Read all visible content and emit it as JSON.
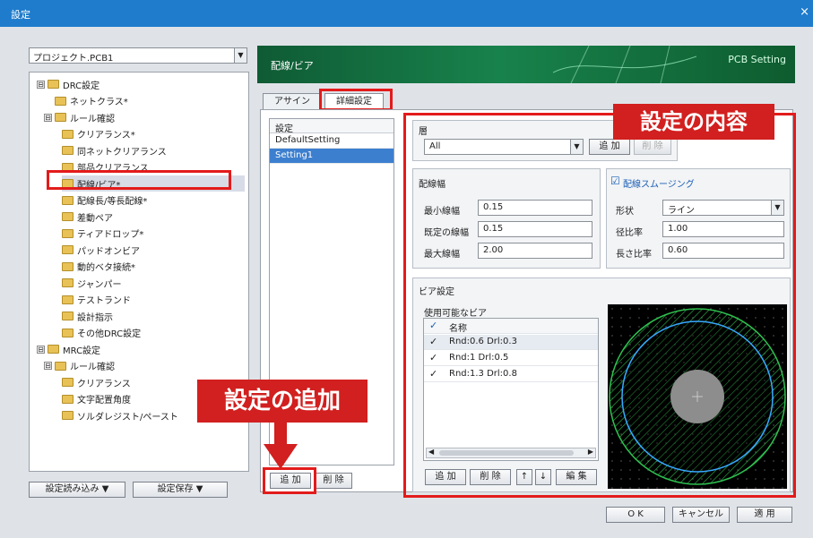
{
  "window": {
    "title": "設定",
    "close_label": "×"
  },
  "project": {
    "value": "プロジェクト.PCB1"
  },
  "tree": [
    {
      "label": "DRC設定",
      "expander": "⊟"
    },
    {
      "label": "ネットクラス*"
    },
    {
      "label": "ルール確認",
      "expander": "⊟"
    },
    {
      "label": "クリアランス*"
    },
    {
      "label": "同ネットクリアランス"
    },
    {
      "label": "部品クリアランス"
    },
    {
      "label": "配線/ビア*"
    },
    {
      "label": "配線長/等長配線*"
    },
    {
      "label": "差動ペア"
    },
    {
      "label": "ティアドロップ*"
    },
    {
      "label": "パッドオンビア"
    },
    {
      "label": "動的ベタ接続*"
    },
    {
      "label": "ジャンパー"
    },
    {
      "label": "テストランド"
    },
    {
      "label": "設計指示"
    },
    {
      "label": "その他DRC設定"
    },
    {
      "label": "MRC設定",
      "expander": "⊟"
    },
    {
      "label": "ルール確認",
      "expander": "⊟"
    },
    {
      "label": "クリアランス"
    },
    {
      "label": "文字配置角度"
    },
    {
      "label": "ソルダレジスト/ペースト"
    }
  ],
  "left_buttons": {
    "load": "設定読み込み ▼",
    "save": "設定保存 ▼"
  },
  "header": {
    "title": "配線/ビア",
    "right": "PCB Setting"
  },
  "tabs": {
    "assign": "アサイン",
    "detail": "詳細設定"
  },
  "settings_list": {
    "header": "設定",
    "items": [
      "DefaultSetting",
      "Setting1"
    ],
    "add": "追 加",
    "delete": "削 除"
  },
  "layer": {
    "label": "層",
    "value": "All",
    "add": "追 加",
    "delete": "削 除"
  },
  "width": {
    "label": "配線幅",
    "min_label": "最小線幅",
    "min_value": "0.15",
    "default_label": "既定の線幅",
    "default_value": "0.15",
    "max_label": "最大線幅",
    "max_value": "2.00"
  },
  "smoothing": {
    "label": "配線スムージング",
    "checked": "☑",
    "shape_label": "形状",
    "shape_value": "ライン",
    "diameter_label": "径比率",
    "diameter_value": "1.00",
    "length_label": "長さ比率",
    "length_value": "0.60"
  },
  "via": {
    "label": "ビア設定",
    "usable_label": "使用可能なビア",
    "col_check": "✓",
    "col_name": "名称",
    "rows": [
      {
        "check": "✓",
        "name": "Rnd:0.6 Drl:0.3"
      },
      {
        "check": "✓",
        "name": "Rnd:1 Drl:0.5"
      },
      {
        "check": "✓",
        "name": "Rnd:1.3 Drl:0.8"
      }
    ],
    "add": "追 加",
    "delete": "削 除",
    "up": "↑",
    "down": "↓",
    "edit": "編 集"
  },
  "callouts": {
    "content": "設定の内容",
    "add": "設定の追加"
  },
  "footer": {
    "ok": "O K",
    "cancel": "キャンセル",
    "apply": "適 用"
  },
  "colors": {
    "title_bar": "#1f7ccc",
    "highlight": "#e31b1b",
    "header_green": "#18824c",
    "selection": "#3d7fcf"
  }
}
